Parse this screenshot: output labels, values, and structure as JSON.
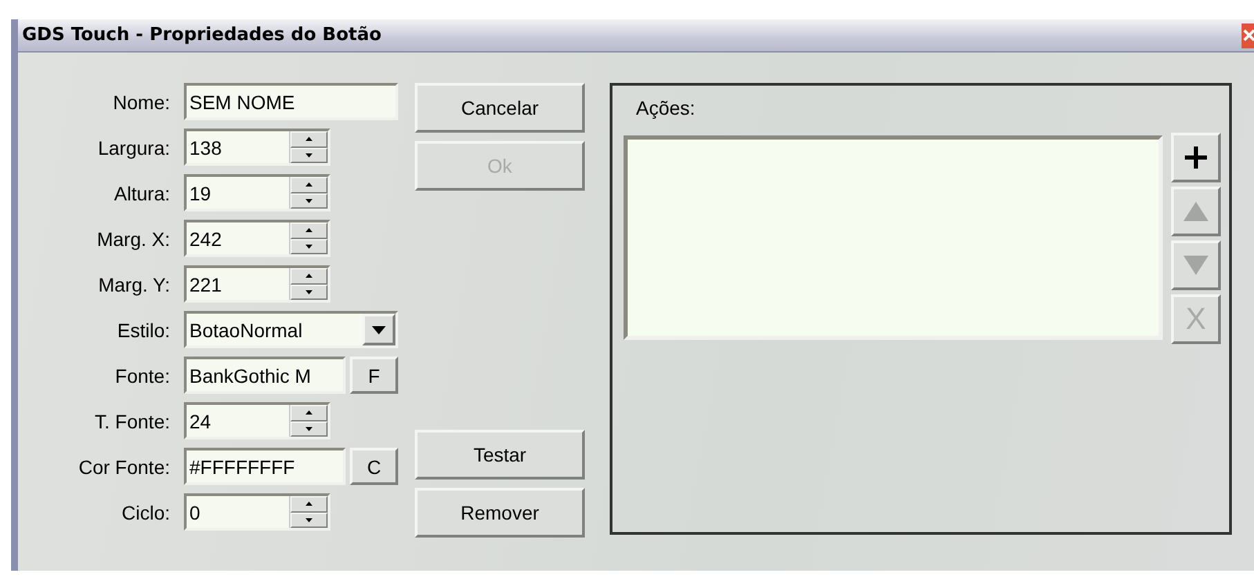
{
  "window": {
    "title": "GDS Touch - Propriedades do Botão"
  },
  "fields": [
    {
      "kind": "text",
      "label": "Nome:",
      "value": "SEM NOME"
    },
    {
      "kind": "spin",
      "label": "Largura:",
      "value": "138"
    },
    {
      "kind": "spin",
      "label": "Altura:",
      "value": "19"
    },
    {
      "kind": "spin",
      "label": "Marg. X:",
      "value": "242"
    },
    {
      "kind": "spin",
      "label": "Marg. Y:",
      "value": "221"
    },
    {
      "kind": "select",
      "label": "Estilo:",
      "value": "BotaoNormal"
    },
    {
      "kind": "picker",
      "label": "Fonte:",
      "value": "BankGothic M",
      "button": "F"
    },
    {
      "kind": "spin",
      "label": "T. Fonte:",
      "value": "24"
    },
    {
      "kind": "picker",
      "label": "Cor Fonte:",
      "value": "#FFFFFFFF",
      "button": "C"
    },
    {
      "kind": "spin",
      "label": "Ciclo:",
      "value": "0"
    }
  ],
  "top_buttons": [
    {
      "label": "Cancelar",
      "disabled": false
    },
    {
      "label": "Ok",
      "disabled": true
    }
  ],
  "bottom_buttons": [
    {
      "label": "Testar",
      "disabled": false
    },
    {
      "label": "Remover",
      "disabled": false
    }
  ],
  "actions": {
    "label": "Ações:",
    "tools": [
      {
        "kind": "add",
        "disabled": false
      },
      {
        "kind": "up",
        "disabled": true
      },
      {
        "kind": "down",
        "disabled": true
      },
      {
        "kind": "delete",
        "label": "X",
        "disabled": true
      }
    ]
  }
}
